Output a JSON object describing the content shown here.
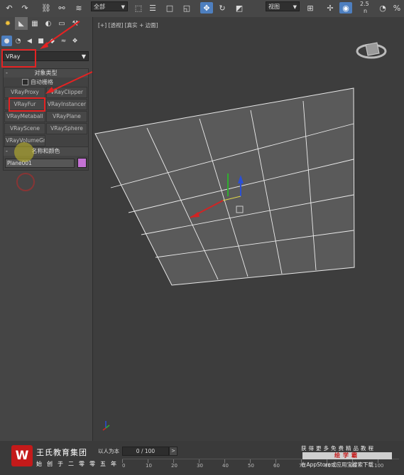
{
  "toolbar": {
    "selection_filter": "全部",
    "reference_coord": "视图",
    "snap_value": "2.5",
    "snap_sub": "n"
  },
  "command_panel": {
    "category": "VRay",
    "object_type": {
      "title": "对象类型",
      "autogrid_label": "自动栅格",
      "buttons": [
        "VRayProxy",
        "VRayClipper",
        "VRayFur",
        "VRayInstancer",
        "VRayMetaball",
        "VRayPlane",
        "VRayScene",
        "VRaySphere",
        "VRayVolumeGrid"
      ]
    },
    "name_color": {
      "title": "名称和颜色",
      "name_value": "Plane001",
      "color": "#c472d4"
    }
  },
  "viewport": {
    "label": "[+] [透视] [真实 + 边面]"
  },
  "timeline": {
    "track_info": "以人为本",
    "time_slider": "0 / 100",
    "ruler_labels": [
      "0",
      "10",
      "20",
      "30",
      "40",
      "50",
      "60",
      "70",
      "80",
      "90",
      "100"
    ]
  },
  "watermark": {
    "company": "王氏教育集团",
    "slogan": "始创于二零零五年",
    "promo_line1": "获得更多免费精品教程",
    "promo_line2": "绘学霸",
    "promo_line3": "在AppStore或应用宝搜索下载"
  },
  "colors": {
    "accent": "#4e7fbf",
    "annotation": "#e52222",
    "brand": "#c41a1a"
  }
}
